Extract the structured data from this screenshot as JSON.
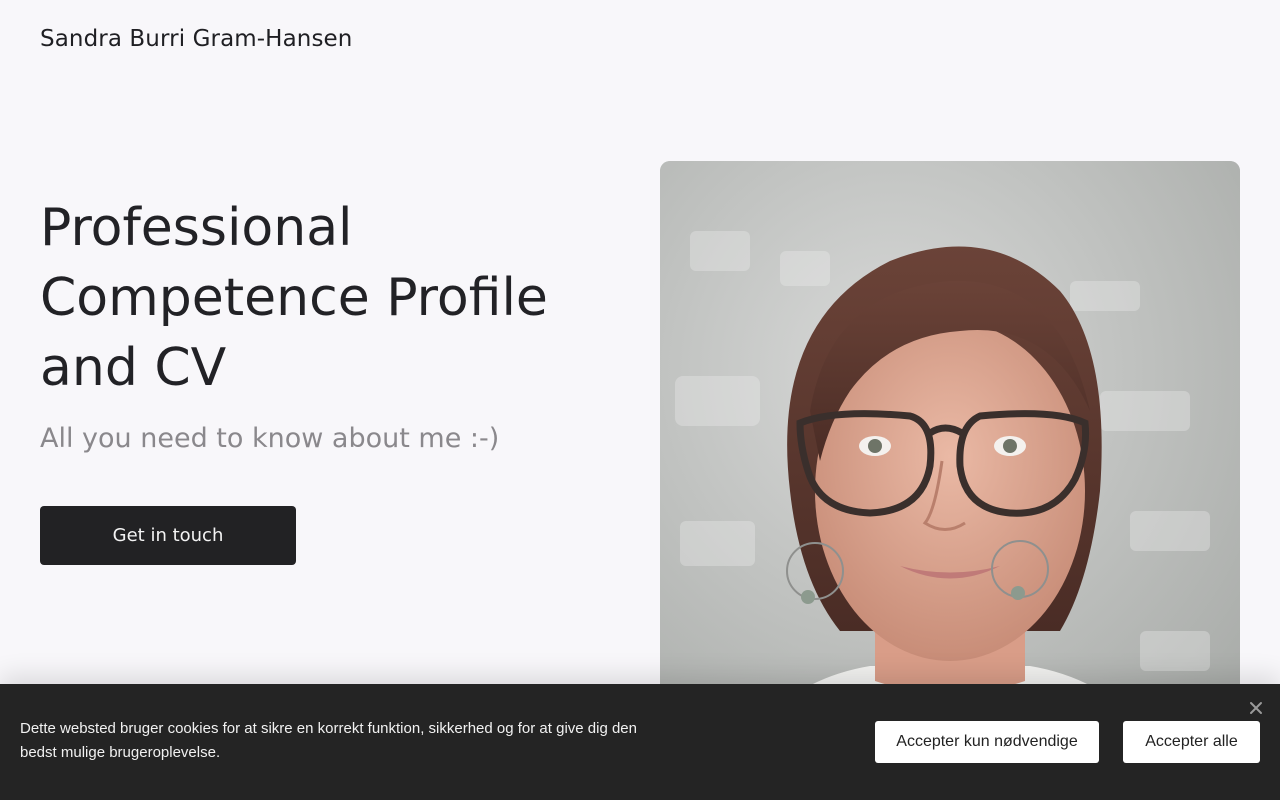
{
  "header": {
    "site_title": "Sandra Burri Gram-Hansen"
  },
  "hero": {
    "title": "Professional Competence Profile and CV",
    "subtitle": "All you need to know about me :-)",
    "cta_label": "Get in touch"
  },
  "cookie_banner": {
    "message": "Dette websted bruger cookies for at sikre en korrekt funktion, sikkerhed og for at give dig den bedst mulige brugeroplevelse.",
    "accept_necessary_label": "Accepter kun nødvendige",
    "accept_all_label": "Accepter alle",
    "close_icon": "close-icon"
  },
  "colors": {
    "page_background": "#f8f7fa",
    "cta_background": "#222224",
    "banner_background": "#242424",
    "subtitle_color": "#8a888c"
  }
}
